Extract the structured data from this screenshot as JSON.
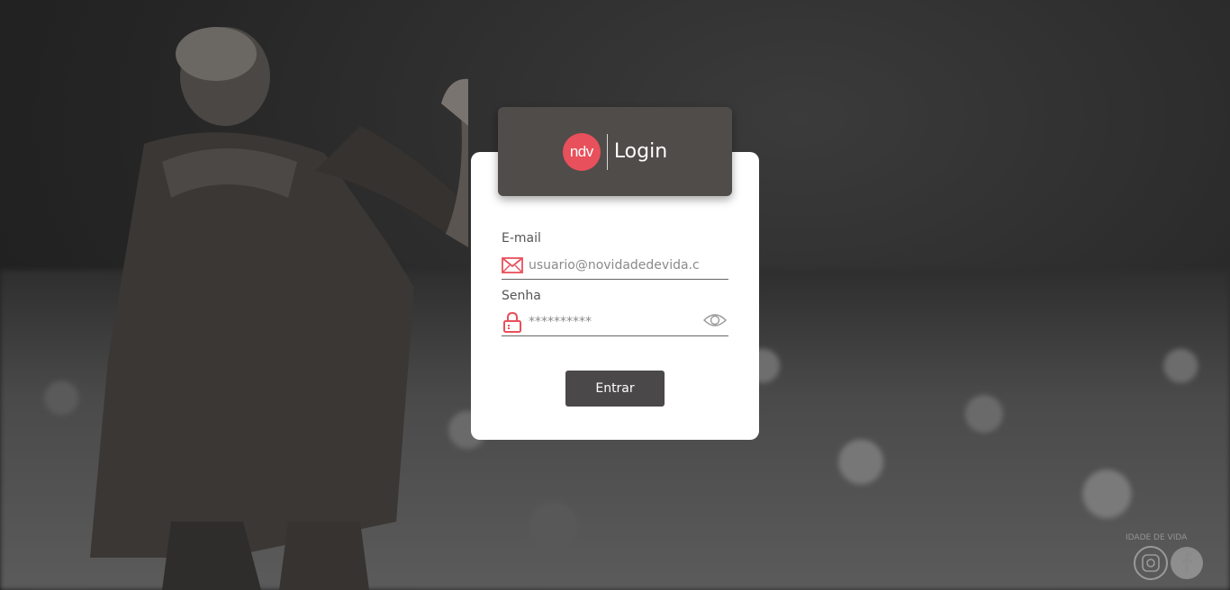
{
  "header": {
    "logo_text": "ndv",
    "title": "Login"
  },
  "form": {
    "email_label": "E-mail",
    "email_placeholder": "usuario@novidadedevida.com",
    "password_label": "Senha",
    "password_placeholder": "**********",
    "submit_label": "Entrar"
  },
  "icons": {
    "email": "envelope-icon",
    "password": "lock-icon",
    "toggle": "eye-icon",
    "social": [
      "instagram-icon",
      "facebook-icon"
    ]
  },
  "colors": {
    "accent": "#e8505b",
    "header_bg": "#4f4c4a",
    "button_bg": "#4a4848"
  },
  "watermark": "IDADE DE VIDA"
}
